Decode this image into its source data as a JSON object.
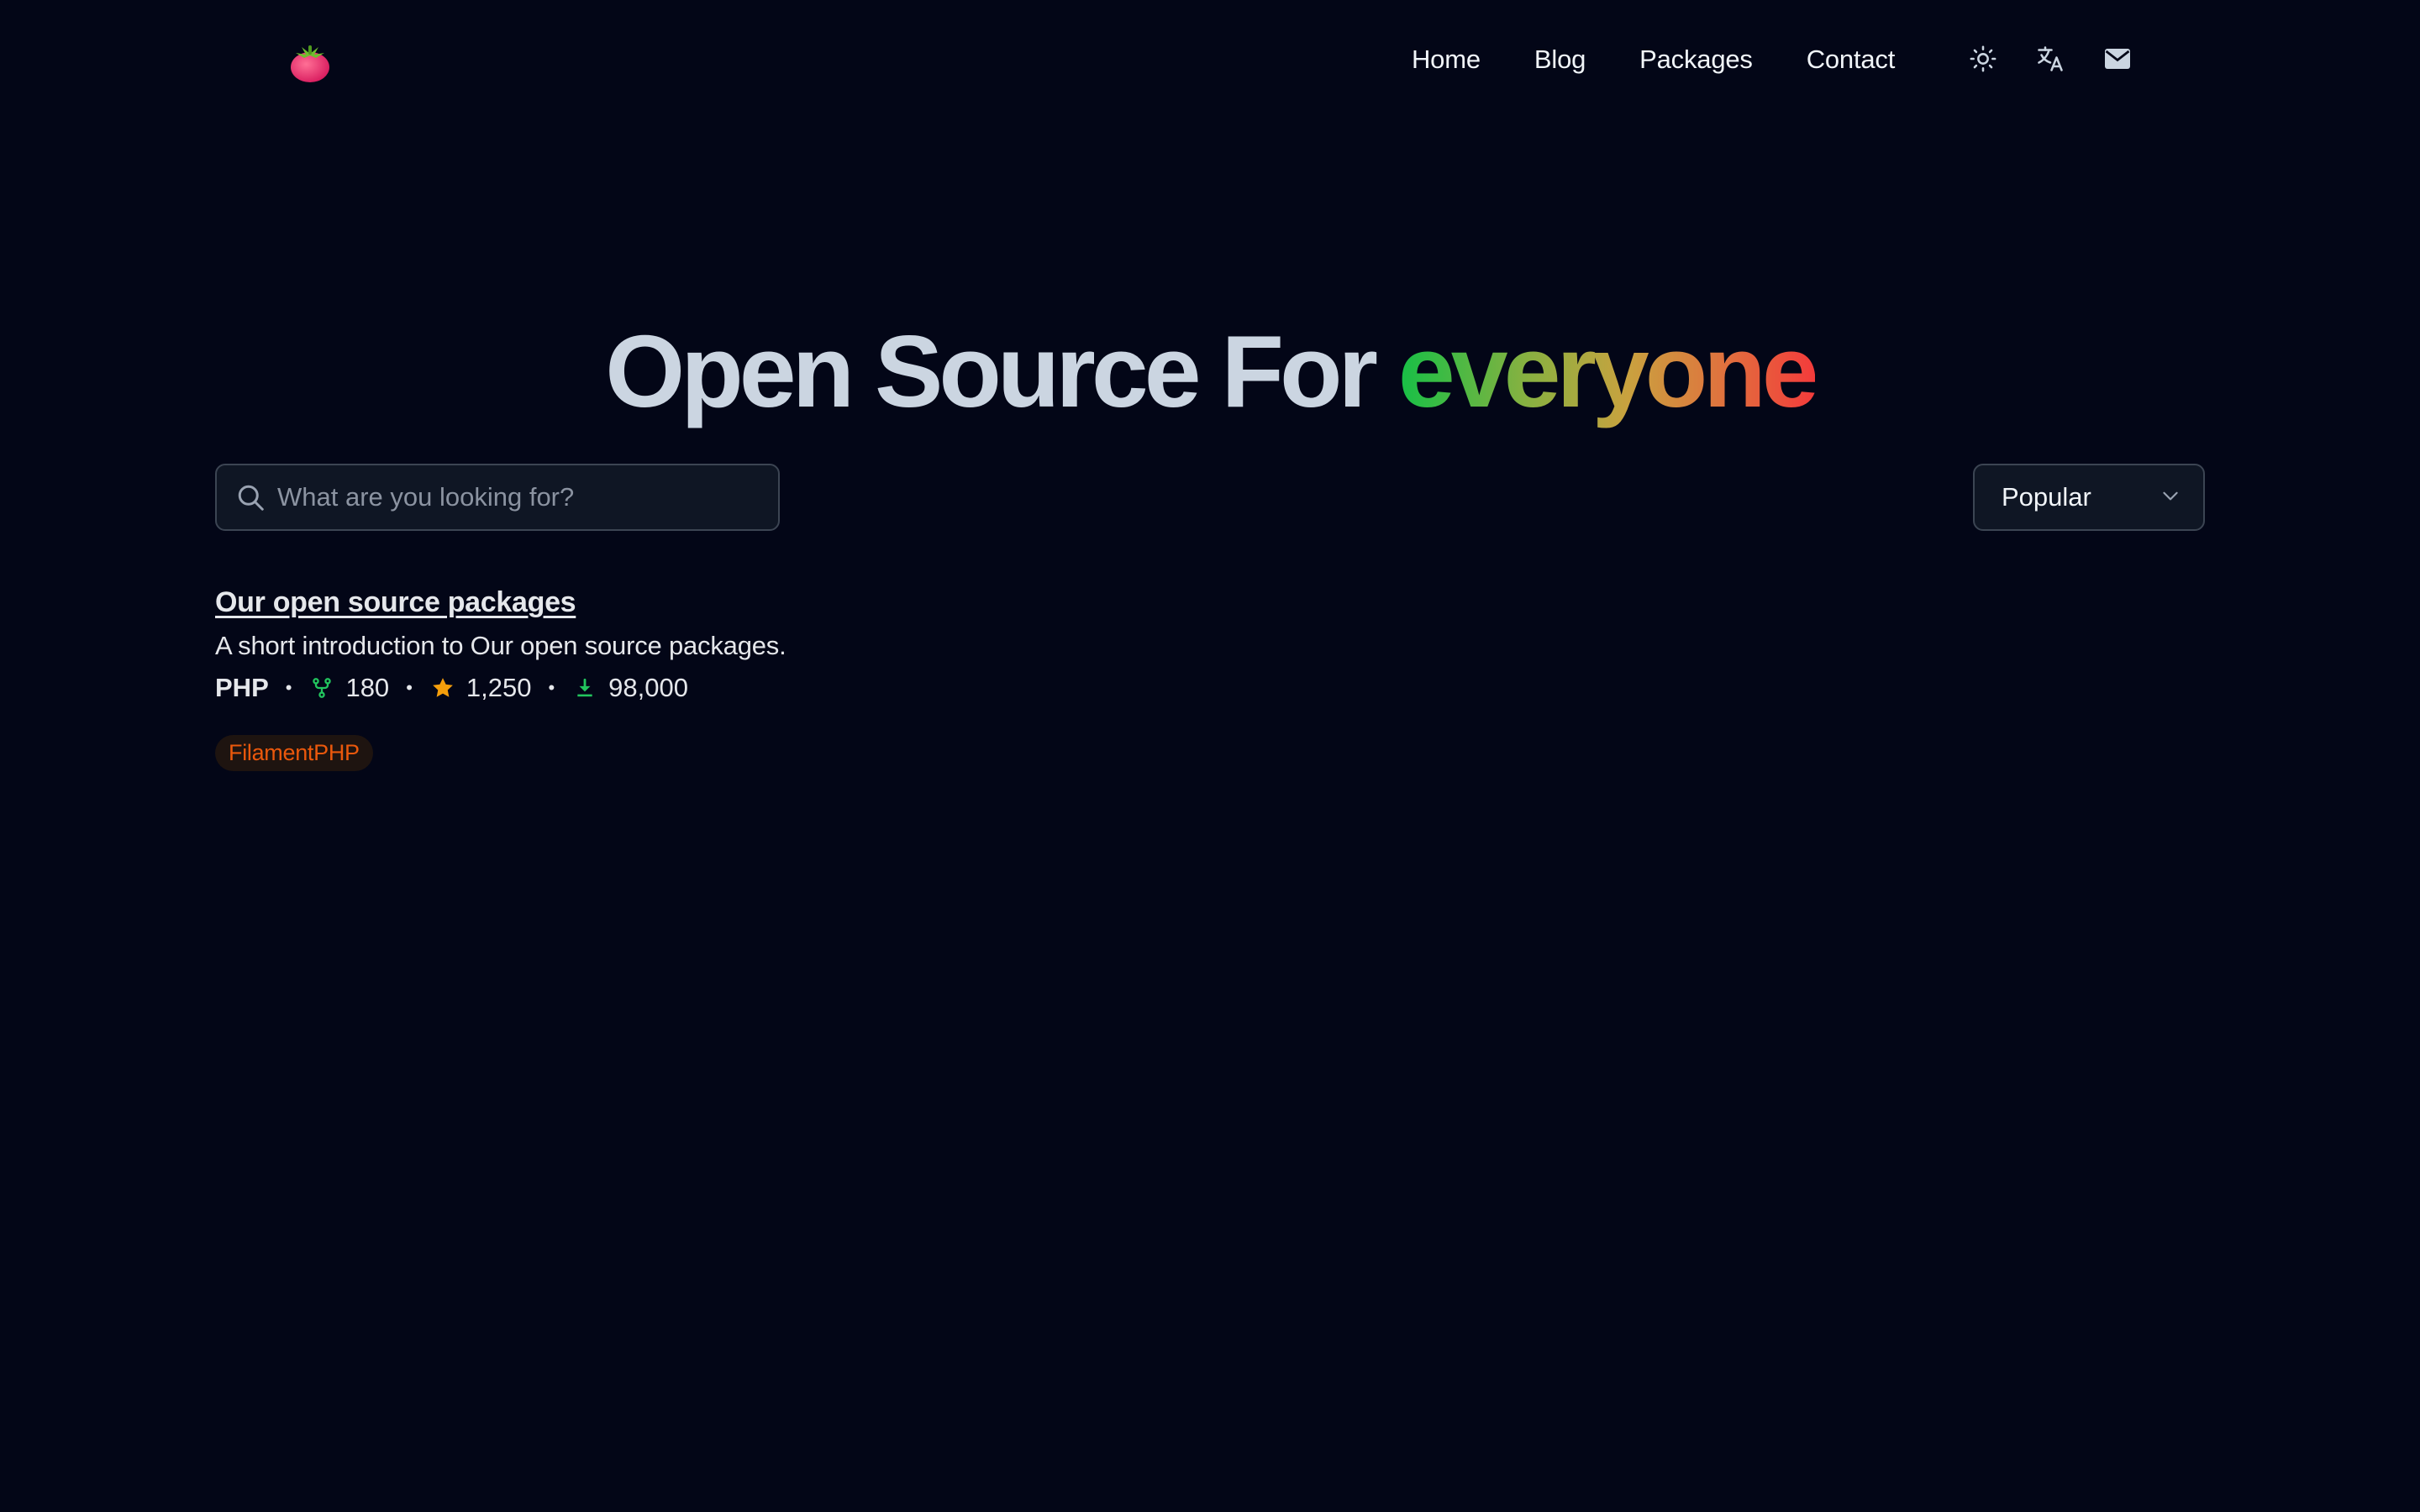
{
  "header": {
    "logo_icon": "tomato-logo-icon",
    "nav": [
      {
        "label": "Home"
      },
      {
        "label": "Blog"
      },
      {
        "label": "Packages"
      },
      {
        "label": "Contact"
      }
    ],
    "icons": [
      "sun-icon",
      "translate-icon",
      "mail-icon"
    ]
  },
  "hero": {
    "title_plain": "Open Source For ",
    "title_highlight": "everyone",
    "gradient_colors": [
      "#16c046",
      "#c9a23f",
      "#f33b3b"
    ]
  },
  "search": {
    "placeholder": "What are you looking for?",
    "value": ""
  },
  "sort": {
    "selected": "Popular"
  },
  "packages": [
    {
      "title": "Our open source packages",
      "description": "A short introduction to Our open source packages.",
      "language": "PHP",
      "forks": "180",
      "stars": "1,250",
      "downloads": "98,000",
      "tags": [
        "FilamentPHP"
      ]
    }
  ],
  "colors": {
    "background": "#030617",
    "fork_icon": "#22c55e",
    "star_icon": "#f59e0b",
    "download_icon": "#22c55e",
    "tag_text": "#ea580c"
  }
}
